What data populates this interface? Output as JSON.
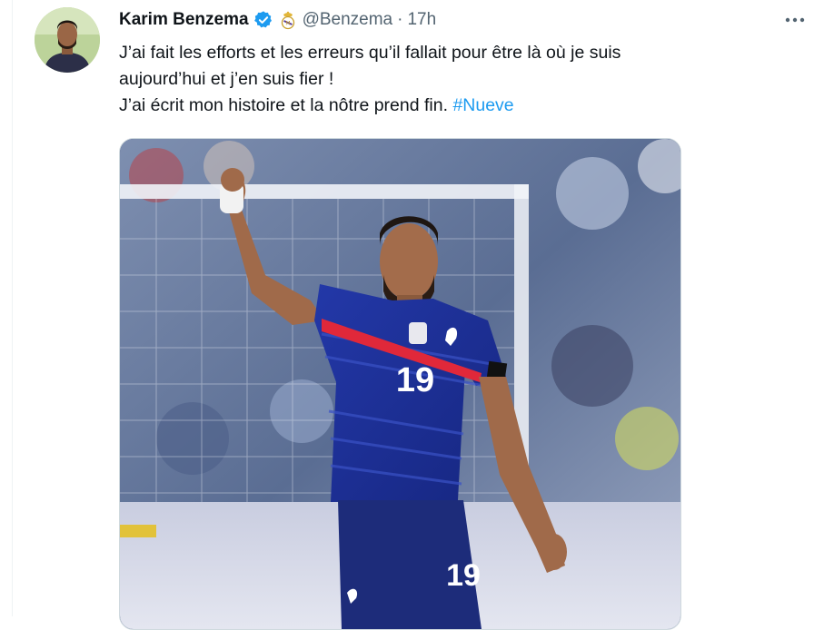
{
  "tweet": {
    "author_name": "Karim Benzema",
    "handle": "@Benzema",
    "separator": "·",
    "time": "17h",
    "verified_icon": "verified-badge-icon",
    "club_icon": "real-madrid-crest-icon",
    "more_icon": "more-options-icon",
    "text_lines": [
      "J’ai fait les efforts et les erreurs qu’il fallait pour être là où je suis",
      "aujourd’hui et j’en suis fier !",
      "J’ai écrit mon histoire et la nôtre prend fin."
    ],
    "hashtag": "#Nueve",
    "jersey_number": "19",
    "short_number": "19"
  },
  "colors": {
    "accent": "#1d9bf0",
    "secondary_text": "#536471",
    "jersey_blue": "#1e2f8c",
    "jersey_red": "#e0283a"
  }
}
